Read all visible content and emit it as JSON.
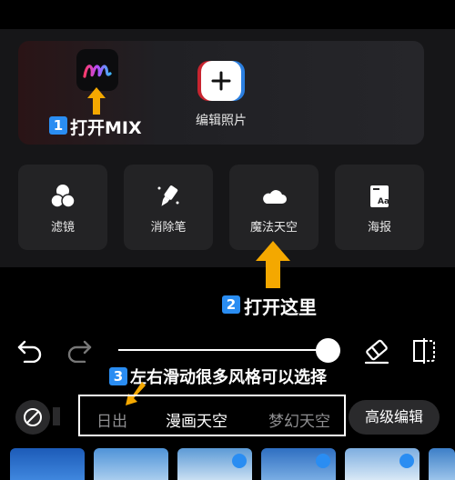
{
  "hero": {
    "app_label": "打开MIX",
    "edit_label": "编辑照片"
  },
  "tools": [
    {
      "label": "滤镜",
      "icon": "filter-circles-icon"
    },
    {
      "label": "消除笔",
      "icon": "eraser-pen-icon"
    },
    {
      "label": "魔法天空",
      "icon": "cloud-icon"
    },
    {
      "label": "海报",
      "icon": "poster-icon"
    }
  ],
  "annotations": {
    "step1": {
      "num": "1",
      "text": "打开MIX"
    },
    "step2": {
      "num": "2",
      "text": "打开这里"
    },
    "step3": {
      "num": "3",
      "text": "左右滑动很多风格可以选择"
    }
  },
  "slider": {
    "value_fraction": 1.0
  },
  "styles": {
    "items": [
      "日出",
      "漫画天空",
      "梦幻天空"
    ],
    "selected": "漫画天空",
    "advanced_label": "高级编辑"
  },
  "colors": {
    "accent_blue": "#2a8df2",
    "annotation_arrow": "#f4a800"
  }
}
